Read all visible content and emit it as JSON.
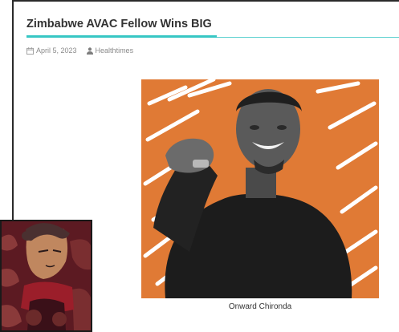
{
  "article": {
    "title": "Zimbabwe AVAC Fellow Wins BIG",
    "date": "April 5, 2023",
    "author": "Healthtimes",
    "image_caption": "Onward Chironda"
  },
  "icons": {
    "date": "calendar-icon",
    "author": "user-icon"
  },
  "colors": {
    "accent": "#37c7c4",
    "photo_background": "#e07a35",
    "thumbnail_background": "#5c1a22"
  }
}
